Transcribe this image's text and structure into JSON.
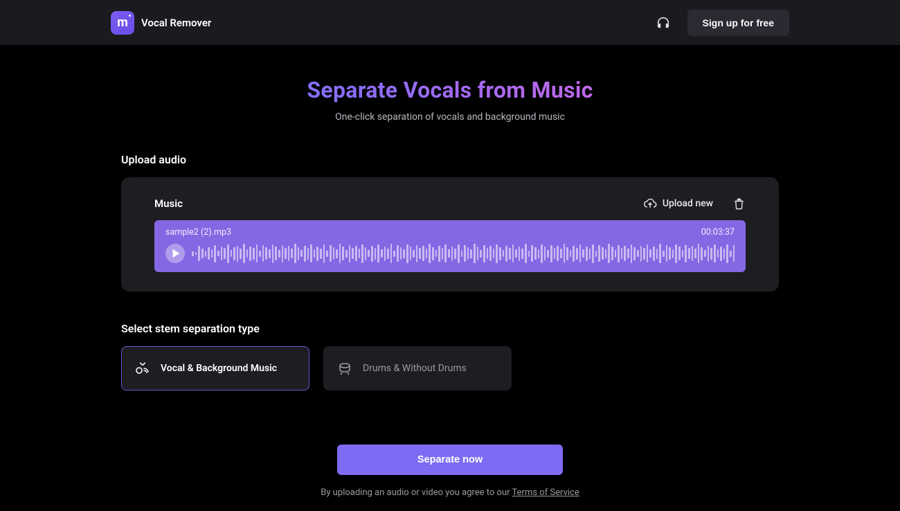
{
  "header": {
    "appTitle": "Vocal Remover",
    "signupLabel": "Sign up for free"
  },
  "hero": {
    "title": "Separate Vocals from Music",
    "subtitle": "One-click separation of vocals and background music"
  },
  "upload": {
    "sectionTitle": "Upload audio",
    "panelLabel": "Music",
    "uploadNewLabel": "Upload new",
    "track": {
      "filename": "sample2 (2).mp3",
      "duration": "00:03:37"
    }
  },
  "stems": {
    "sectionTitle": "Select stem separation type",
    "options": [
      {
        "label": "Vocal & Background Music",
        "selected": true
      },
      {
        "label": "Drums & Without Drums",
        "selected": false
      }
    ]
  },
  "cta": {
    "buttonLabel": "Separate now",
    "disclaimerPrefix": "By uploading an audio or video you agree to our ",
    "tosLabel": "Terms of Service"
  }
}
